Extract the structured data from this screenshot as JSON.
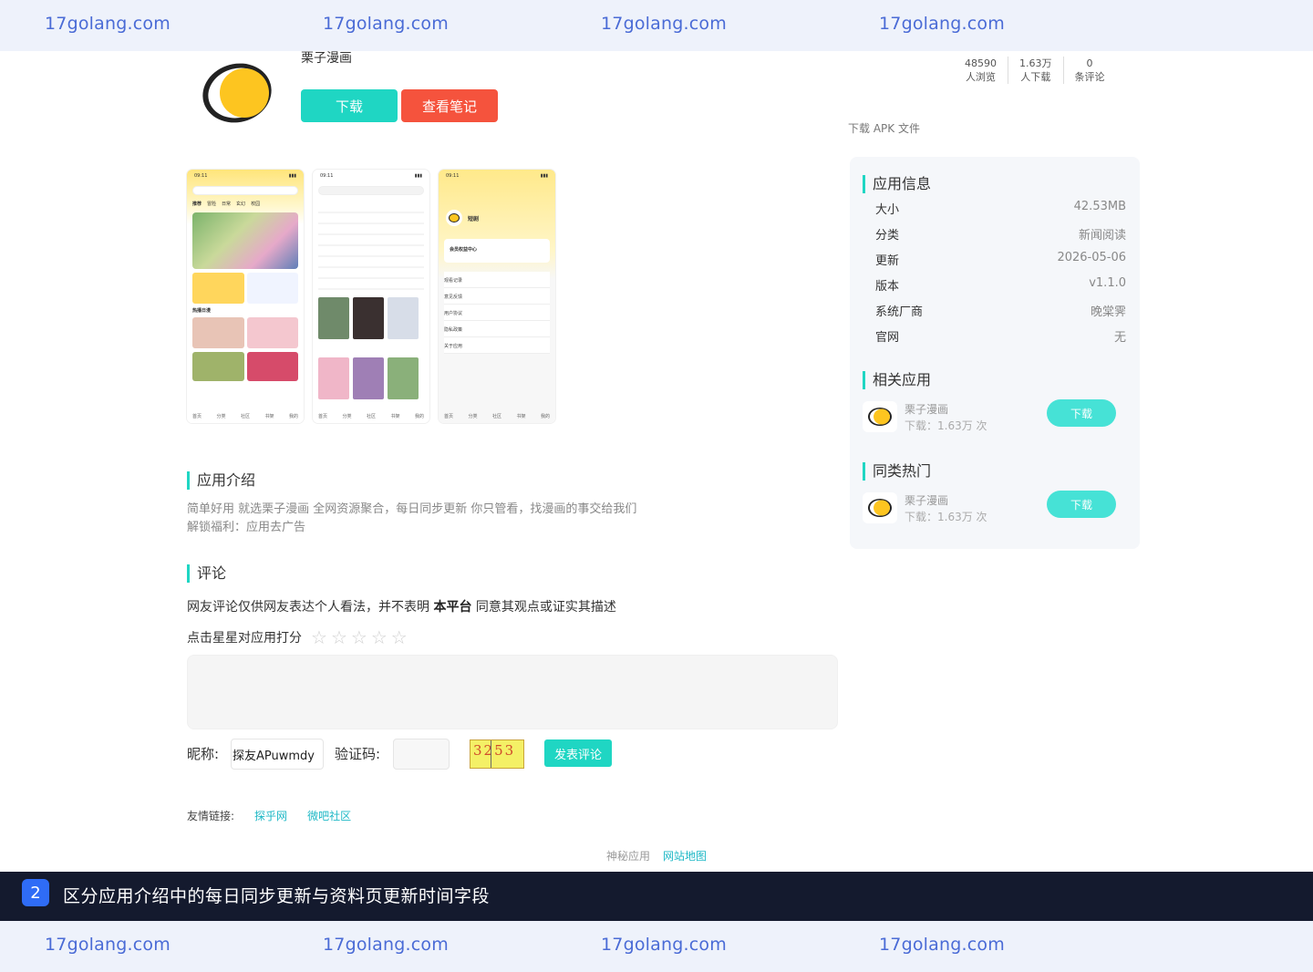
{
  "watermark": {
    "text": "17golang.com"
  },
  "app": {
    "name": "栗子漫画",
    "download_label": "下载",
    "notes_label": "查看笔记",
    "apk_link": "下载 APK 文件",
    "icon": "chestnut-logo-icon"
  },
  "stats": [
    {
      "value": "48590",
      "label": "人浏览"
    },
    {
      "value": "1.63万",
      "label": "人下载"
    },
    {
      "value": "0",
      "label": "条评论"
    }
  ],
  "screens": {
    "status_time": "09:11",
    "tabs": [
      "推荐",
      "冒险",
      "日常",
      "玄幻",
      "校园",
      "搞笑"
    ],
    "bottom_nav": [
      "首页",
      "分类",
      "社区",
      "书架",
      "我的"
    ],
    "search_placeholder": "搜漫画 作者名",
    "profile_user": "短剧",
    "profile_vip": "会员权益中心",
    "profile_menu": [
      "观看记录",
      "意见反馈",
      "用户协议",
      "隐私政策",
      "关于应用"
    ],
    "section_label": "热播日漫"
  },
  "intro": {
    "title": "应用介绍",
    "line1": "简单好用 就选栗子漫画 全网资源聚合，每日同步更新 你只管看，找漫画的事交给我们",
    "line2": "解锁福利：应用去广告"
  },
  "comments": {
    "title": "评论",
    "disclaimer_pre": "网友评论仅供网友表达个人看法，并不表明",
    "disclaimer_bold": "本平台",
    "disclaimer_post": "同意其观点或证实其描述",
    "rate_label": "点击星星对应用打分",
    "rating": 0,
    "star_count": 5,
    "nick_label": "昵称:",
    "nick_value": "探友APuwmdy",
    "captcha_label": "验证码:",
    "captcha_text": "3253",
    "submit_label": "发表评论"
  },
  "friends": {
    "label": "友情链接:",
    "links": [
      "探乎网",
      "微吧社区"
    ]
  },
  "footer": {
    "muted": "神秘应用",
    "link": "网站地图"
  },
  "sidebar": {
    "info_title": "应用信息",
    "info": [
      {
        "k": "大小",
        "v": "42.53MB"
      },
      {
        "k": "分类",
        "v": "新闻阅读"
      },
      {
        "k": "更新",
        "v": "2026-05-06"
      },
      {
        "k": "版本",
        "v": "v1.1.0"
      },
      {
        "k": "系统厂商",
        "v": "晚棠霁"
      },
      {
        "k": "官网",
        "v": "无"
      }
    ],
    "related_title": "相关应用",
    "related": {
      "name": "栗子漫画",
      "count": "下载：1.63万 次",
      "btn": "下载"
    },
    "hot_title": "同类热门",
    "hot": {
      "name": "栗子漫画",
      "count": "下载：1.63万 次",
      "btn": "下载"
    }
  },
  "task": {
    "number": "2",
    "text": "区分应用介绍中的每日同步更新与资料页更新时间字段"
  },
  "colors": {
    "accent": "#1fd6c3",
    "danger": "#f5533d",
    "watermark": "#4a6bd6",
    "banner_bg": "#141a2e",
    "badge": "#2f6cf6"
  }
}
